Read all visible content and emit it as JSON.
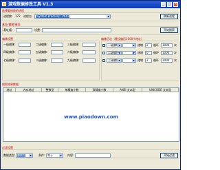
{
  "window": {
    "title": "游戏数据修改工具 V1.3",
    "controls": {
      "minimize": "_",
      "maximize": "□",
      "close": "×"
    }
  },
  "process_section": {
    "header": "选择要修改的进程",
    "pid_label": "进程数:",
    "pid_value": "172",
    "process_label": "进程名:",
    "process_value": "[System Process]：PID:0",
    "refresh_button": "刷新进程"
  },
  "init_section": {
    "header": "基址/偏移/基址",
    "address_label": "基址值:",
    "address_value": "",
    "setting_label": "设置:",
    "setting_value": "",
    "search_button": "开始搜索"
  },
  "offset_section": {
    "header": "偏移设置",
    "rows": [
      [
        "一级偏移:",
        "二级偏移:",
        "三级偏移:"
      ],
      [
        "四级偏移:",
        "五级偏移:",
        "六级偏移:"
      ],
      [
        "七级偏移:",
        "八级偏移:",
        "九级偏移:"
      ]
    ]
  },
  "loop_section": {
    "header": "偏移历次（需设偏历1000个地址）",
    "rows": [
      {
        "checked": true,
        "label": "一级偏移",
        "step_label": "递增",
        "step": "2",
        "loop_label": "循环",
        "loop": "1000",
        "unit": "次"
      },
      {
        "checked": false,
        "label": "二级偏移",
        "step_label": "递增",
        "step": "0",
        "loop_label": "循环",
        "loop": "1000",
        "unit": "次"
      },
      {
        "checked": false,
        "label": "三级偏移",
        "step_label": "递增",
        "step": "2",
        "loop_label": "循环",
        "loop": "1000",
        "unit": "次"
      }
    ]
  },
  "result_section": {
    "header": "搜索结果数据",
    "columns": [
      "地址",
      "内存地址",
      "整数型",
      "单精度小数",
      "双精度小数",
      "ANSI 文本型",
      "UNICODE 文本型"
    ],
    "watermark": "www.piaodown.com"
  },
  "filter_section": {
    "header": "过滤设置",
    "type_label": "数据类型:",
    "type_value": "整数型",
    "cond_label": "条件:",
    "cond_value": "等于",
    "content_label": "内容:",
    "content_value": "",
    "filter_button": "开始过滤"
  },
  "colors": {
    "section_header": "#c00000",
    "titlebar": "#0a3fb8",
    "watermark": "#2050c0",
    "selection": "#316ac5"
  }
}
